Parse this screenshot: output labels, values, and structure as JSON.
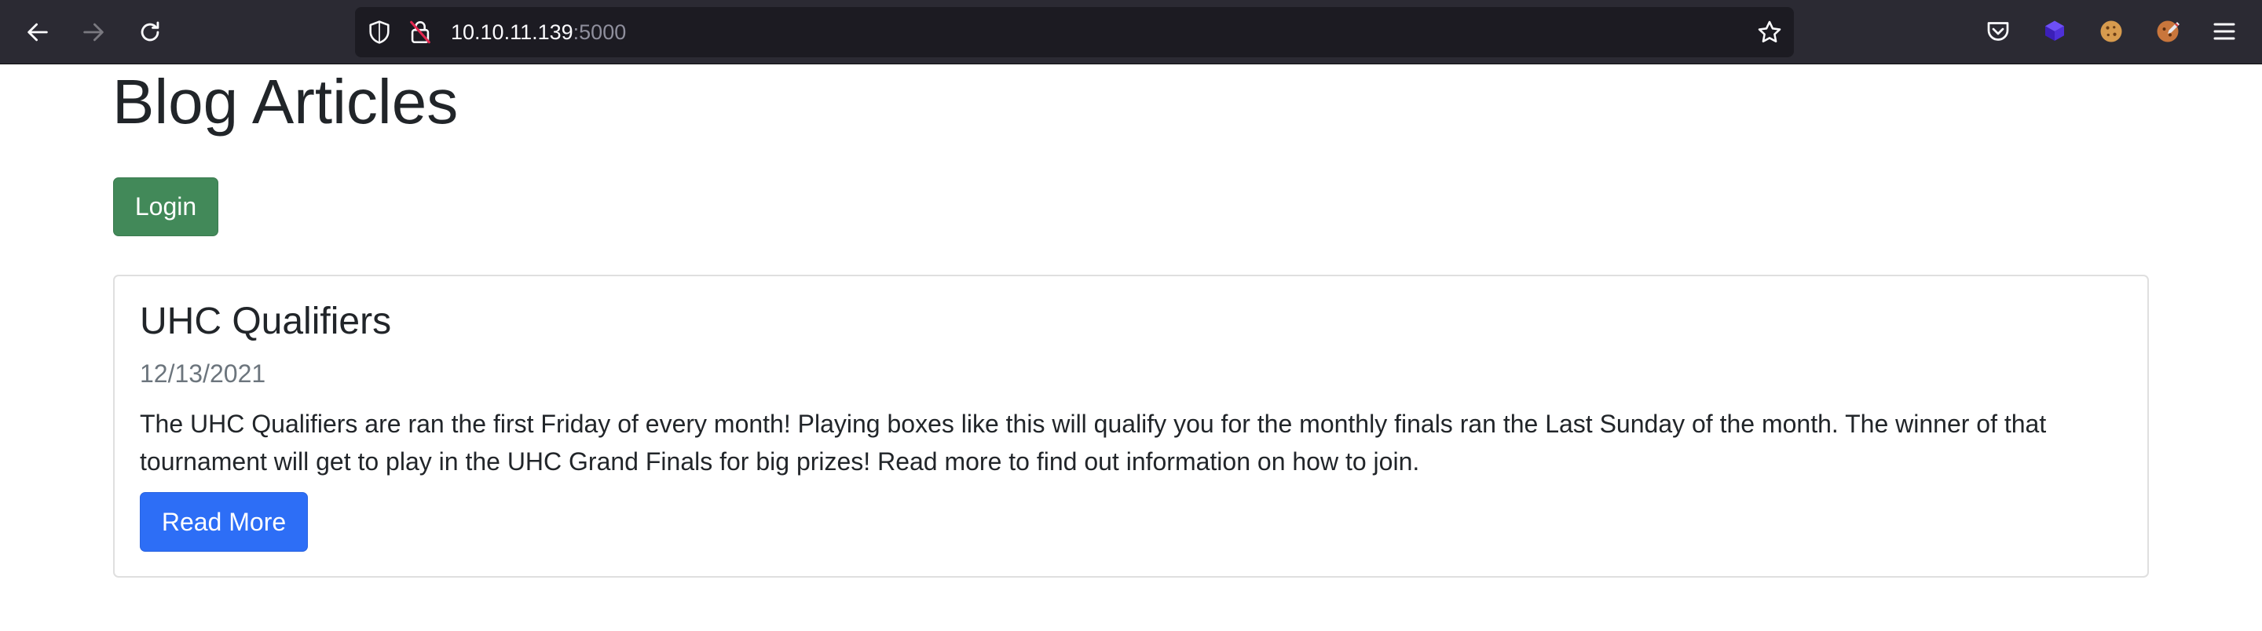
{
  "browser": {
    "url_host": "10.10.11.139",
    "url_port": ":5000",
    "icons": {
      "back": "back-arrow-icon",
      "forward": "forward-arrow-icon",
      "reload": "reload-icon",
      "tracking": "shield-icon",
      "connection": "insecure-lock-icon",
      "bookmark": "star-icon",
      "pocket": "pocket-icon",
      "ext1": "purple-cube-extension-icon",
      "ext2": "cookie-extension-icon",
      "ext3": "cookie-editor-extension-icon",
      "menu": "hamburger-menu-icon"
    }
  },
  "page": {
    "title": "Blog Articles",
    "login_label": "Login"
  },
  "articles": [
    {
      "title": "UHC Qualifiers",
      "date": "12/13/2021",
      "body": "The UHC Qualifiers are ran the first Friday of every month! Playing boxes like this will qualify you for the monthly finals ran the Last Sunday of the month. The winner of that tournament will get to play in the UHC Grand Finals for big prizes! Read more to find out information on how to join.",
      "button_label": "Read More"
    }
  ],
  "colors": {
    "toolbar_bg": "#2b2a33",
    "urlbar_bg": "#1c1b22",
    "login_green": "#428959",
    "read_more_blue": "#2d6ef6",
    "muted_text": "#6c757d"
  }
}
